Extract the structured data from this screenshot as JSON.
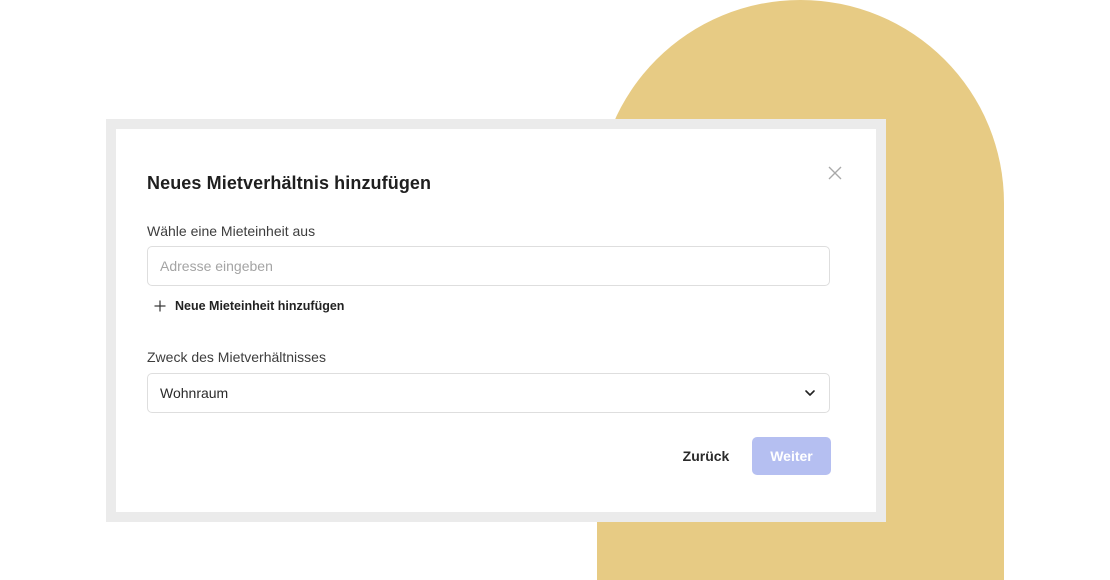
{
  "dialog": {
    "title": "Neues Mietverhältnis hinzufügen",
    "close_icon": "close-icon"
  },
  "unit": {
    "label": "Wähle eine Mieteinheit aus",
    "address_placeholder": "Adresse eingeben",
    "address_value": "",
    "add_link_label": "Neue Mieteinheit hinzufügen",
    "add_icon": "plus-icon"
  },
  "purpose": {
    "label": "Zweck des Mietverhältnisses",
    "selected": "Wohnraum",
    "chevron_icon": "chevron-down-icon"
  },
  "actions": {
    "back_label": "Zurück",
    "next_label": "Weiter"
  },
  "colors": {
    "arch": "#e7cb84",
    "frame": "#ebebeb",
    "next_button": "#b5bff1"
  }
}
